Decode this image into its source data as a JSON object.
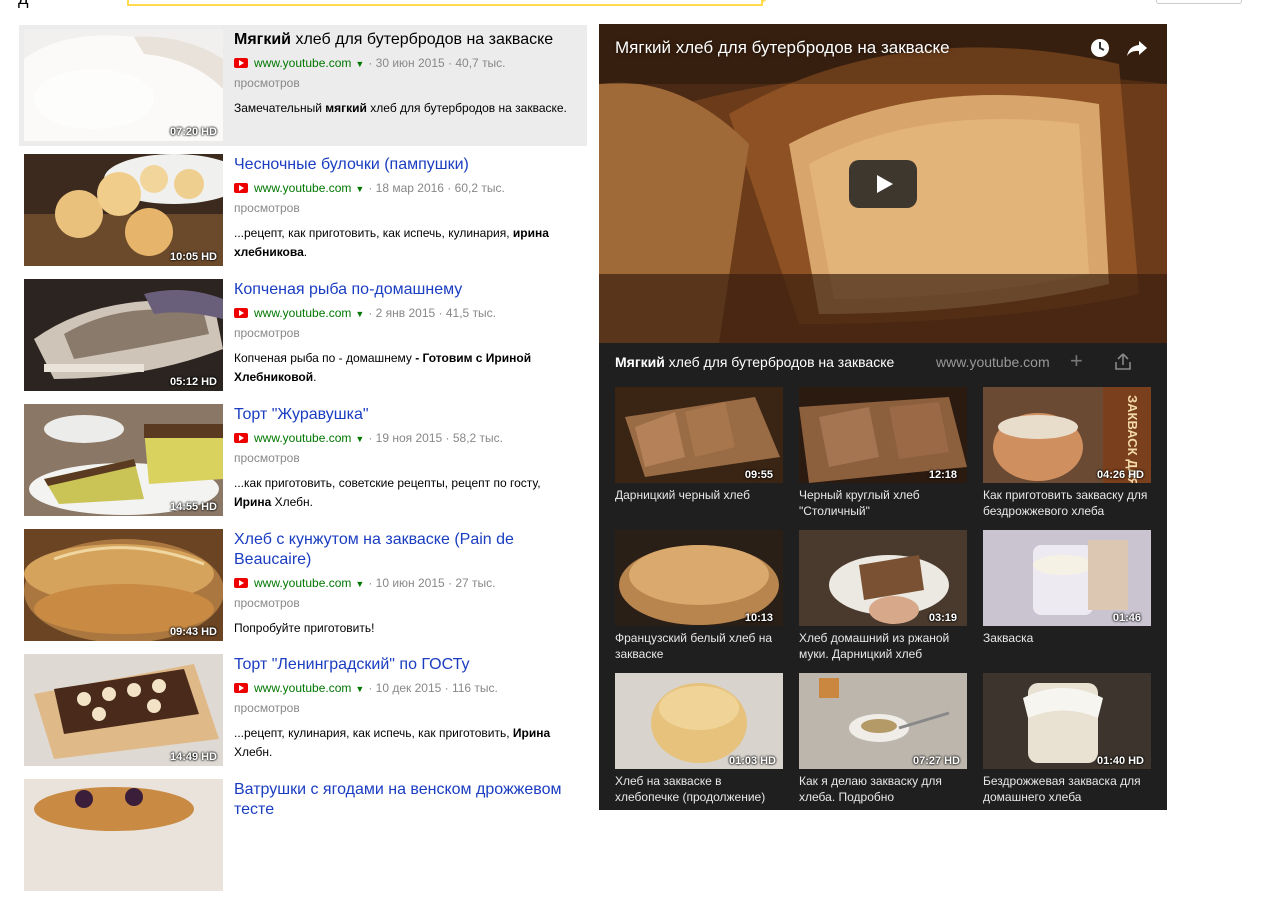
{
  "top": {
    "logo_fragment": "д"
  },
  "results": [
    {
      "title_bold": "Мягкий",
      "title_rest": " хлеб для бутербродов на закваске",
      "url": "www.youtube.com",
      "date": "30 июн 2015",
      "views_a": "40,7 тыс.",
      "views_b": "просмотров",
      "desc_a": "Замечательный ",
      "desc_b": "мягкий",
      "desc_c": " хлеб для бутербродов на закваске.",
      "duration": "07:20",
      "hd": "HD"
    },
    {
      "title_bold": "",
      "title_rest": "Чесночные булочки (пампушки)",
      "url": "www.youtube.com",
      "date": "18 мар 2016",
      "views_a": "60,2 тыс.",
      "views_b": "просмотров",
      "desc_a": "...рецепт, как приготовить, как испечь, кулинария, ",
      "desc_b": "ирина хлебникова",
      "desc_c": ".",
      "duration": "10:05",
      "hd": "HD"
    },
    {
      "title_bold": "",
      "title_rest": "Копченая рыба по-домашнему",
      "url": "www.youtube.com",
      "date": "2 янв 2015",
      "views_a": "41,5 тыс.",
      "views_b": "просмотров",
      "desc_a": "Копченая рыба по - домашнему ",
      "desc_b": "- Готовим с Ириной Хлебниковой",
      "desc_c": ".",
      "duration": "05:12",
      "hd": "HD"
    },
    {
      "title_bold": "",
      "title_rest": "Торт \"Журавушка\"",
      "url": "www.youtube.com",
      "date": "19 ноя 2015",
      "views_a": "58,2 тыс.",
      "views_b": "просмотров",
      "desc_a": "...как приготовить, советские рецепты, рецепт по госту, ",
      "desc_b": "Ирина",
      "desc_c": " Хлебн.",
      "duration": "14:55",
      "hd": "HD"
    },
    {
      "title_bold": "",
      "title_rest": "Хлеб с кунжутом на закваске (Pain de Beaucaire)",
      "url": "www.youtube.com",
      "date": "10 июн 2015",
      "views_a": "27 тыс.",
      "views_b": "просмотров",
      "desc_a": "Попробуйте приготовить!",
      "desc_b": "",
      "desc_c": "",
      "duration": "09:43",
      "hd": "HD"
    },
    {
      "title_bold": "",
      "title_rest": "Торт \"Ленинградский\" по ГОСТу",
      "url": "www.youtube.com",
      "date": "10 дек 2015",
      "views_a": "116 тыс.",
      "views_b": "просмотров",
      "desc_a": "...рецепт, кулинария, как испечь, как приготовить, ",
      "desc_b": "Ирина",
      "desc_c": " Хлебн.",
      "duration": "14:49",
      "hd": "HD"
    },
    {
      "title_bold": "",
      "title_rest": "Ватрушки с ягодами на венском дрожжевом тесте",
      "url": "",
      "date": "",
      "views_a": "",
      "views_b": "",
      "desc_a": "",
      "desc_b": "",
      "desc_c": "",
      "duration": "",
      "hd": ""
    }
  ],
  "player": {
    "video_title": "Мягкий хлеб для бутербродов на закваске",
    "bar_title_bold": "Мягкий",
    "bar_title_rest": " хлеб для бутербродов на закваске",
    "bar_url": "www.youtube.com",
    "plus": "+",
    "related": [
      {
        "label": "Дарницкий черный хлеб",
        "duration": "09:55",
        "hd": ""
      },
      {
        "label": "Черный круглый хлеб \"Столичный\"",
        "duration": "12:18",
        "hd": ""
      },
      {
        "label": "Как приготовить закваску для бездрожжевого хлеба",
        "duration": "04:26",
        "hd": "HD",
        "overlay": "ЗАКВАСК ДЛЯ ХЛЕБ"
      },
      {
        "label": "Французский белый хлеб на закваске",
        "duration": "10:13",
        "hd": ""
      },
      {
        "label": "Хлеб домашний из ржаной муки. Дарницкий хлеб",
        "duration": "03:19",
        "hd": ""
      },
      {
        "label": "Закваска",
        "duration": "01:46",
        "hd": ""
      },
      {
        "label": "Хлеб на закваске в хлебопечке (продолжение)",
        "duration": "01:03",
        "hd": "HD"
      },
      {
        "label": "Как я делаю закваску для хлеба. Подробно",
        "duration": "07:27",
        "hd": "HD"
      },
      {
        "label": "Бездрожжевая закваска для домашнего хлеба",
        "duration": "01:40",
        "hd": "HD"
      }
    ]
  },
  "colors": {
    "link": "#1a3dc1",
    "url_green": "#007700",
    "player_bg": "#1f1f1f",
    "search_yellow": "#ffdb4d"
  },
  "icons": [
    "youtube-icon",
    "clock-icon",
    "share-icon",
    "play-icon",
    "plus-icon",
    "upload-icon"
  ]
}
